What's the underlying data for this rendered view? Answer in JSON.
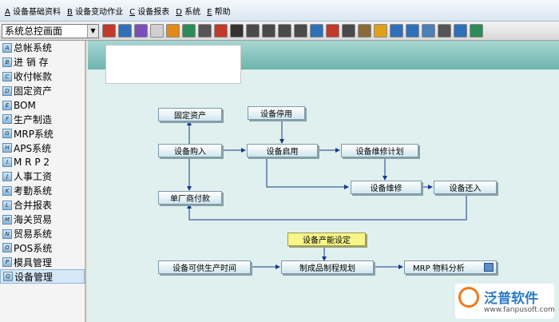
{
  "menu": [
    {
      "key": "A",
      "label": "设备基础资料"
    },
    {
      "key": "B",
      "label": "设备变动作业"
    },
    {
      "key": "C",
      "label": "设备报表"
    },
    {
      "key": "D",
      "label": "系统"
    },
    {
      "key": "E",
      "label": "帮助"
    }
  ],
  "toolbar": {
    "combo_value": "系统总控画面",
    "icons": [
      {
        "name": "hook-icon",
        "color": "#c0392b"
      },
      {
        "name": "bus-icon",
        "color": "#2e6fb8"
      },
      {
        "name": "book-icon",
        "color": "#7a4fb8"
      },
      {
        "name": "document-icon",
        "color": "#d0d0d0"
      },
      {
        "name": "folder-icon",
        "color": "#e08a1a"
      },
      {
        "name": "globe-icon",
        "color": "#2e8b57"
      },
      {
        "name": "people-icon",
        "color": "#555555"
      },
      {
        "name": "flag-icon",
        "color": "#c0392b"
      },
      {
        "name": "arrow-icon",
        "color": "#333333"
      },
      {
        "name": "note-icon",
        "color": "#4a4a4a"
      },
      {
        "name": "draw-icon",
        "color": "#4a4a4a"
      },
      {
        "name": "line-icon",
        "color": "#4a4a4a"
      },
      {
        "name": "eraser-icon",
        "color": "#4a4a4a"
      },
      {
        "name": "grid-icon",
        "color": "#2e6fb8"
      },
      {
        "name": "chart-icon",
        "color": "#c0392b"
      },
      {
        "name": "window-icon",
        "color": "#4a4a4a"
      },
      {
        "name": "building-icon",
        "color": "#8a6a3a"
      },
      {
        "name": "sound-icon",
        "color": "#e0a01a"
      },
      {
        "name": "format-icon",
        "color": "#2e6fb8"
      },
      {
        "name": "clipboard-icon",
        "color": "#2e6fb8"
      },
      {
        "name": "copy-icon",
        "color": "#4a7fb8"
      },
      {
        "name": "close-icon",
        "color": "#555555"
      },
      {
        "name": "table-icon",
        "color": "#2e6fb8"
      },
      {
        "name": "exit-icon",
        "color": "#2e8b57"
      }
    ]
  },
  "sidebar": {
    "items": [
      {
        "key": "A",
        "label": "总帐系统"
      },
      {
        "key": "B",
        "label": "进 销 存"
      },
      {
        "key": "C",
        "label": "收付帐款"
      },
      {
        "key": "D",
        "label": "固定资产"
      },
      {
        "key": "E",
        "label": "BOM"
      },
      {
        "key": "F",
        "label": "生产制造"
      },
      {
        "key": "G",
        "label": "MRP系统"
      },
      {
        "key": "H",
        "label": "APS系统"
      },
      {
        "key": "I",
        "label": "M R P 2"
      },
      {
        "key": "J",
        "label": "人事工资"
      },
      {
        "key": "K",
        "label": "考勤系统"
      },
      {
        "key": "L",
        "label": "合并报表"
      },
      {
        "key": "M",
        "label": "海关贸易"
      },
      {
        "key": "N",
        "label": "贸易系统"
      },
      {
        "key": "O",
        "label": "POS系统"
      },
      {
        "key": "P",
        "label": "模具管理"
      },
      {
        "key": "Q",
        "label": "设备管理"
      }
    ],
    "active_index": 16
  },
  "flow": {
    "fixed_assets": "固定资产",
    "equipment_stop": "设备停用",
    "equipment_purchase": "设备购入",
    "equipment_enable": "设备启用",
    "maintenance_plan": "设备维修计划",
    "equipment_repair": "设备维修",
    "equipment_return": "设备还入",
    "vendor_payment": "单厂商付款",
    "capacity_setting": "设备产能设定",
    "available_time": "设备可供生产时间",
    "production_schedule": "制成品制程规划",
    "mrp_analysis": "MRP 物料分析"
  },
  "logo": {
    "name": "泛普软件",
    "url": "www.fanpusoft.com"
  }
}
